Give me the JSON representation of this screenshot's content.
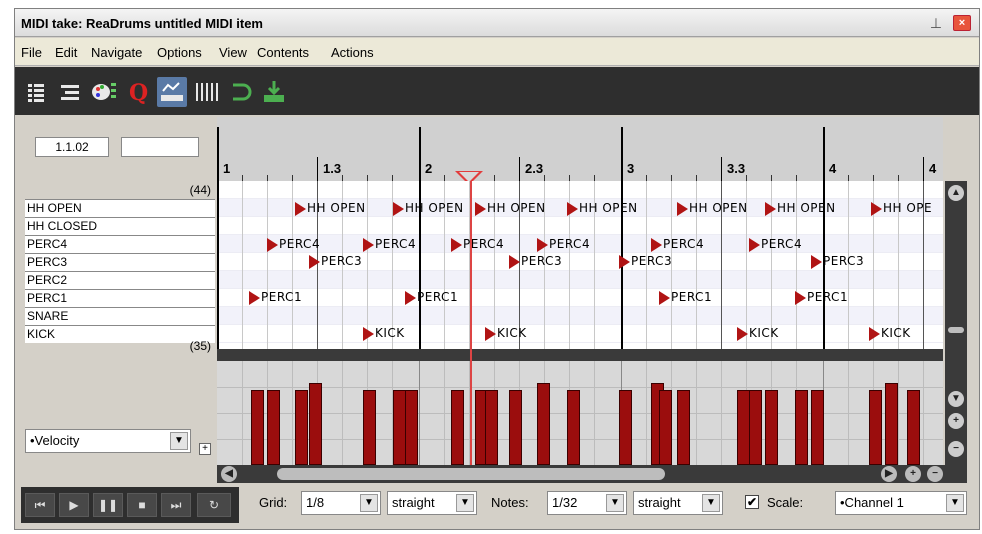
{
  "window": {
    "title": "MIDI take: ReaDrums untitled MIDI item",
    "pin_glyph": "⊥",
    "close_glyph": "×"
  },
  "menu": [
    "File",
    "Edit",
    "Navigate",
    "Options",
    "View",
    "Contents",
    "Actions"
  ],
  "toolbar": {
    "icons": [
      "piano-roll-icon",
      "named-notes-icon",
      "color-palette-icon",
      "quantize-icon",
      "event-properties-icon",
      "grid-icon",
      "loop-icon",
      "insert-icon"
    ]
  },
  "position": {
    "current": "1.1.02",
    "length": ""
  },
  "ruler": {
    "labels": [
      "1",
      "1.3",
      "2",
      "2.3",
      "3",
      "3.3",
      "4",
      "4"
    ]
  },
  "notes_list": {
    "top_range": "(44)",
    "bottom_range": "(35)",
    "names": [
      "HH OPEN",
      "HH CLOSED",
      "PERC4",
      "PERC3",
      "PERC2",
      "PERC1",
      "SNARE",
      "KICK"
    ]
  },
  "notes": {
    "hh_open": "HH OPEN",
    "hh_open_cut1": "HH OPEN",
    "hh_open_cut2": "HH OPE",
    "perc4": "PERC4",
    "perc3": "PERC3",
    "perc1": "PERC1",
    "kick": "KICK"
  },
  "cc_lane": {
    "selected": "•Velocity",
    "velocities": [
      92,
      92,
      92,
      100,
      92,
      92,
      92,
      92,
      92,
      92,
      92,
      100,
      92,
      92,
      100,
      92,
      92,
      92,
      92,
      92,
      92,
      92,
      92,
      100,
      92
    ]
  },
  "transport": {
    "buttons": [
      "go-to-start-icon",
      "play-icon",
      "pause-icon",
      "stop-icon",
      "go-to-end-icon",
      "loop-toggle-icon"
    ],
    "glyphs": [
      "⏮",
      "▶",
      "❚❚",
      "■",
      "⏭",
      "↻"
    ]
  },
  "bottom": {
    "grid_label": "Grid:",
    "grid_value": "1/8",
    "grid_mode": "straight",
    "notes_label": "Notes:",
    "notes_value": "1/32",
    "notes_mode": "straight",
    "scale_checked": "✔",
    "scale_label": "Scale:",
    "channel": "•Channel 1"
  },
  "colors": {
    "note": "#b01414",
    "velocity": "#9b0d0d",
    "playhead": "#e23c3c",
    "toolbar": "#2e2e2e"
  }
}
